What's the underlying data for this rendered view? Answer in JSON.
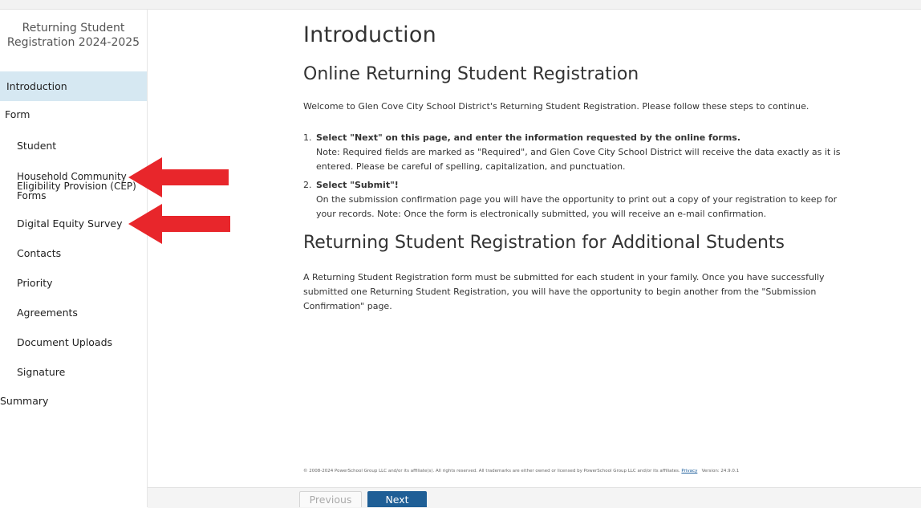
{
  "sidebar": {
    "title_line1": "Returning Student",
    "title_line2": "Registration 2024-2025",
    "items": [
      {
        "label": "Introduction"
      },
      {
        "label": "Form"
      },
      {
        "label": "Student"
      },
      {
        "label_line1": "Household Community",
        "label_line2": "Eligibility Provision (CEP)",
        "label_line3": "Forms"
      },
      {
        "label": "Digital Equity Survey"
      },
      {
        "label": "Contacts"
      },
      {
        "label": "Priority"
      },
      {
        "label": "Agreements"
      },
      {
        "label": "Document Uploads"
      },
      {
        "label": "Signature"
      },
      {
        "label": "Summary"
      }
    ]
  },
  "main": {
    "heading": "Introduction",
    "subheading": "Online Returning Student Registration",
    "welcome": "Welcome to Glen Cove City School District's Returning Student Registration.  Please follow these steps to continue.",
    "steps": [
      {
        "num": "1.",
        "title": "Select \"Next\" on this page, and enter the information requested by the online forms.",
        "line1": "Note: Required fields are marked as \"Required\", and Glen Cove City School District will receive the data exactly as it is",
        "line2": "entered.  Please be careful of spelling, capitalization, and punctuation."
      },
      {
        "num": "2.",
        "title": "Select \"Submit\"!",
        "line1": "On the submission confirmation page you will have the opportunity to print out a copy of your registration to keep for",
        "line2": "your records.  Note:  Once the form is electronically submitted, you will receive an e-mail confirmation."
      }
    ],
    "additional_heading": "Returning Student Registration for Additional Students",
    "additional_line1": "A Returning Student Registration form must be submitted for each student in your family. Once you have successfully",
    "additional_line2": "submitted one Returning Student Registration, you will have the opportunity to begin another from the \"Submission",
    "additional_line3": "Confirmation\" page."
  },
  "footer": {
    "copyright": "© 2008-2024 PowerSchool Group LLC and/or its affiliate(s). All rights reserved. All trademarks are either owned or licensed by PowerSchool Group LLC and/or its affiliates.",
    "privacy_link": "Privacy",
    "version": "Version: 24.9.0.1"
  },
  "buttons": {
    "previous": "Previous",
    "next": "Next"
  },
  "colors": {
    "active_nav_bg": "#d6e8f2",
    "next_button": "#1f5f96",
    "annotation_arrow": "#e8262b"
  }
}
